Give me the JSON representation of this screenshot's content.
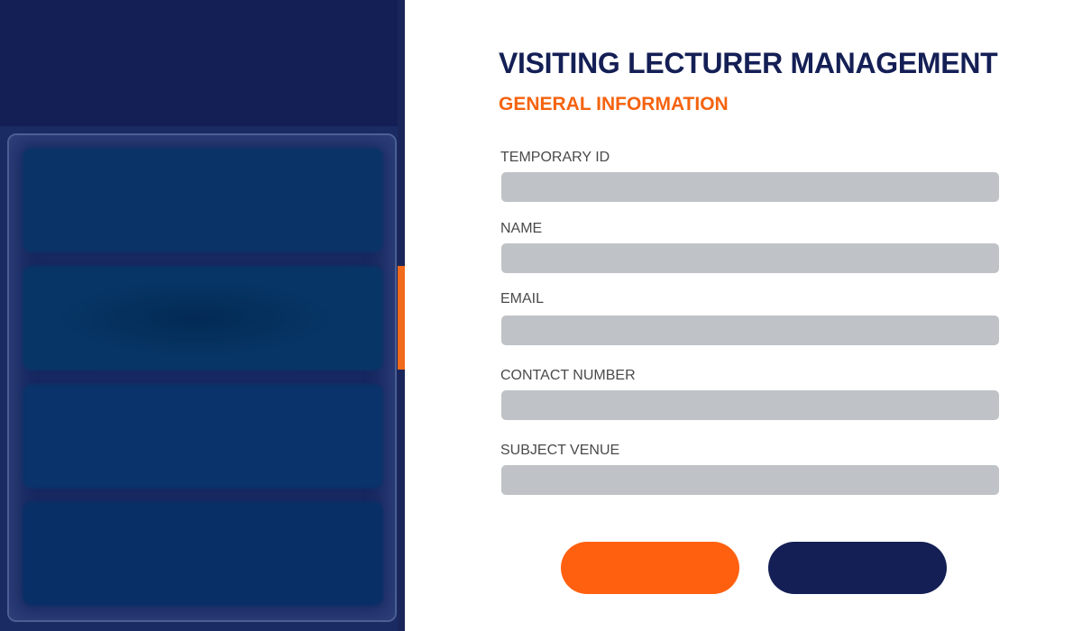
{
  "app": {
    "title": "VISITING LECTURER MANAGEMENT",
    "section": "GENERAL INFORMATION"
  },
  "sidebar": {
    "active_index": 1,
    "items": [
      {
        "label": ""
      },
      {
        "label": ""
      },
      {
        "label": ""
      },
      {
        "label": ""
      }
    ]
  },
  "form": {
    "fields": [
      {
        "label": "TEMPORARY ID",
        "value": "",
        "placeholder": ""
      },
      {
        "label": "NAME",
        "value": "",
        "placeholder": ""
      },
      {
        "label": "EMAIL",
        "value": "",
        "placeholder": ""
      },
      {
        "label": "CONTACT NUMBER",
        "value": "",
        "placeholder": ""
      },
      {
        "label": "SUBJECT VENUE",
        "value": "",
        "placeholder": ""
      }
    ],
    "primary_button_label": "",
    "secondary_button_label": ""
  },
  "colors": {
    "brand_navy": "#141f55",
    "accent_orange": "#ff6010",
    "input_gray": "#bfc2c6"
  }
}
